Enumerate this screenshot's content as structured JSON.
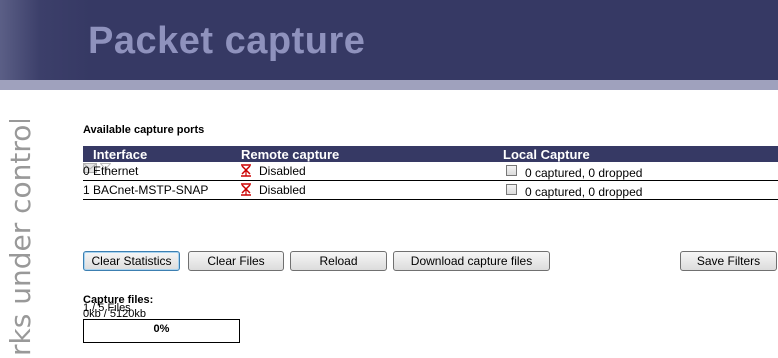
{
  "header": {
    "title": "Packet capture"
  },
  "tagline": "rks under control",
  "ports": {
    "section_title": "Available capture ports",
    "columns": {
      "interface": "Interface",
      "remote": "Remote capture",
      "local": "Local Capture"
    },
    "rows": [
      {
        "interface": "0 Ethernet",
        "remote": "Disabled",
        "local": "0 captured, 0 dropped",
        "local_checked": false
      },
      {
        "interface": "1 BACnet-MSTP-SNAP",
        "remote": "Disabled",
        "local": "0 captured, 0 dropped",
        "local_checked": false
      }
    ]
  },
  "buttons": {
    "clear_statistics": "Clear Statistics",
    "clear_files": "Clear Files",
    "reload": "Reload",
    "download": "Download capture files",
    "save_filters": "Save Filters"
  },
  "capture_files": {
    "section_title": "Capture files:",
    "file_count": "1 / 5 Files",
    "size": "0kb / 5120kb",
    "progress_label": "0%",
    "progress_fraction": 0
  },
  "colors": {
    "accent": "#363964",
    "title": "#8f92bd",
    "disabled_icon": "#cc0000"
  },
  "icons": {
    "remote": "x-stand-icon",
    "local": "mail-icon",
    "filter": "filter-icon"
  }
}
